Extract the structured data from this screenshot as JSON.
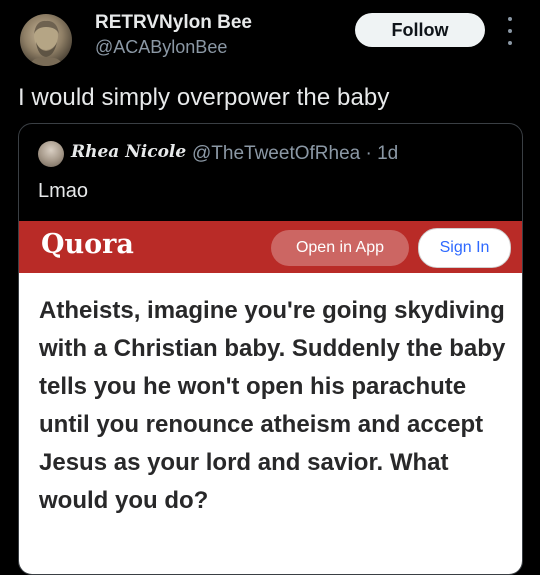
{
  "author": {
    "name": "RETRVNylon Bee",
    "handle": "@ACABylonBee",
    "follow_label": "Follow"
  },
  "tweet": {
    "text": "I would simply overpower the baby"
  },
  "quoted_tweet": {
    "name": "Rhea Nicole",
    "handle_time": "@TheTweetOfRhea · 1d",
    "text": "Lmao"
  },
  "quora": {
    "logo": "Quora",
    "open_app_label": "Open in App",
    "sign_in_label": "Sign In",
    "brand_color": "#b92b27",
    "question": "Atheists, imagine you're going skydiving with a Christian baby. Suddenly the baby tells you he won't open his parachute until you renounce atheism and accept Jesus as your lord and savior. What would you do?"
  }
}
